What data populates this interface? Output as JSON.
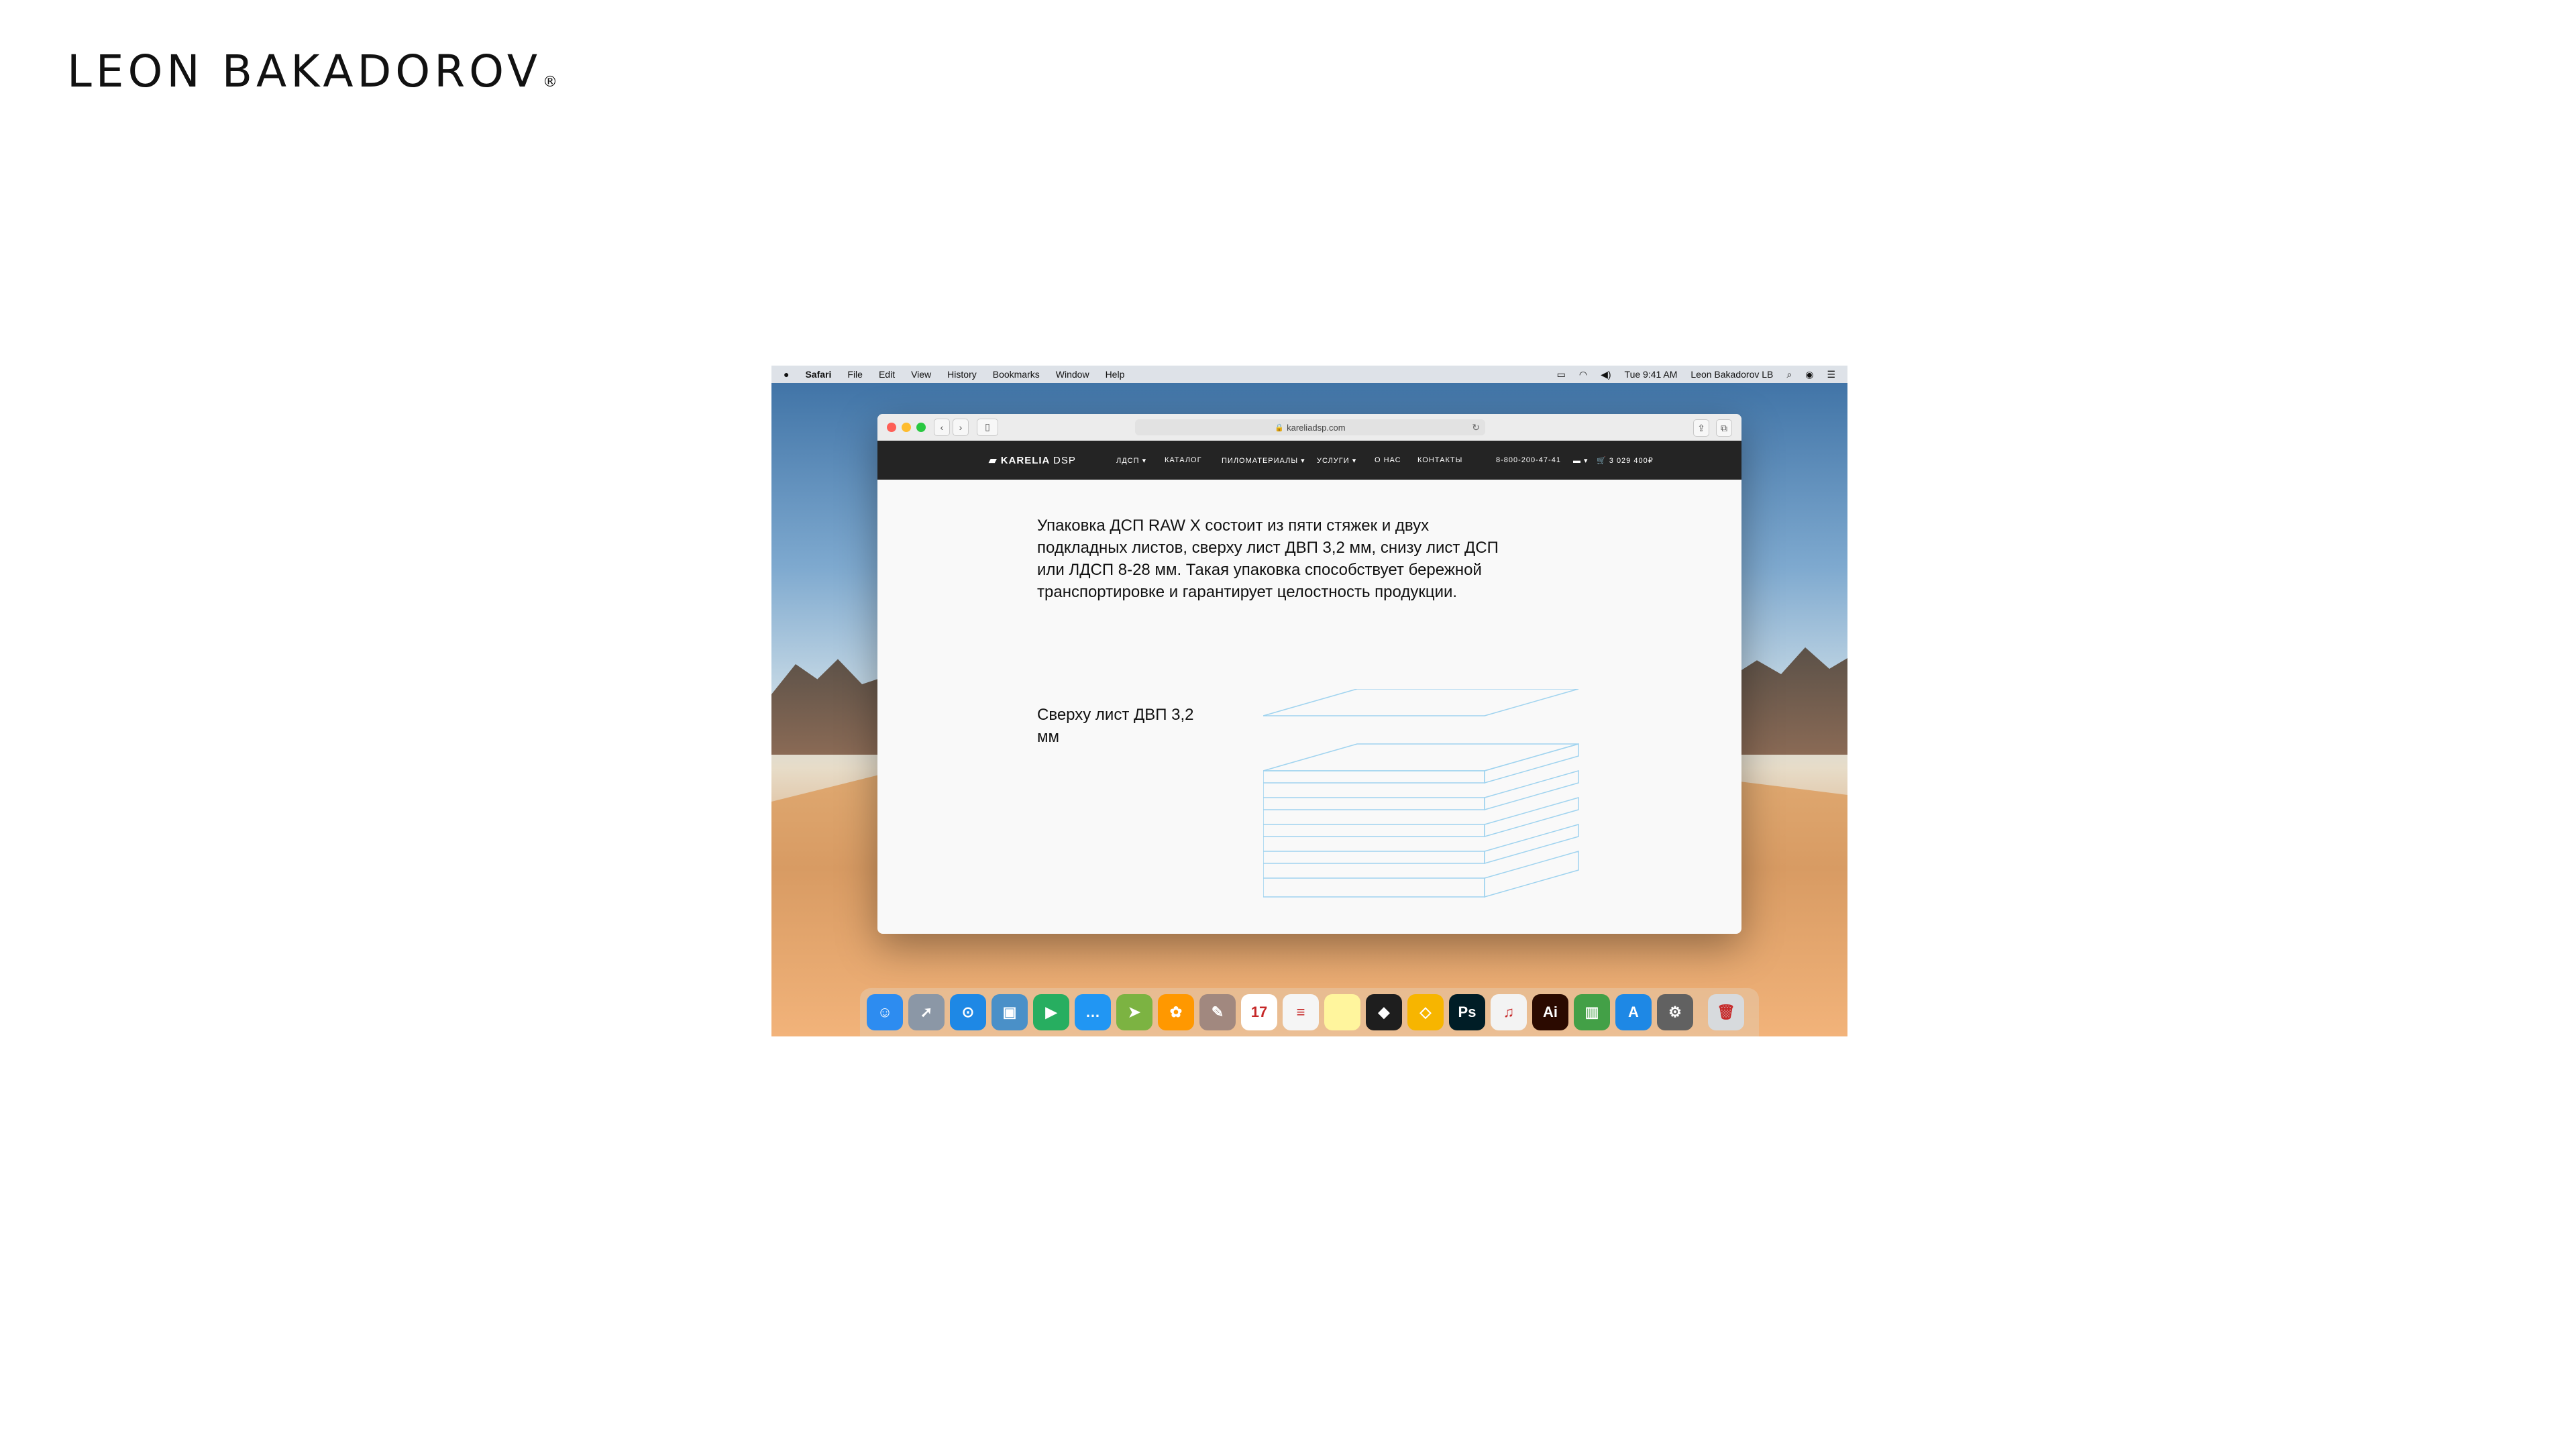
{
  "brand": {
    "name": "LEON BAKADOROV",
    "mark": "®"
  },
  "menubar": {
    "apple_icon": "apple-icon",
    "app": "Safari",
    "menus": [
      "File",
      "Edit",
      "View",
      "History",
      "Bookmarks",
      "Window",
      "Help"
    ],
    "clock": "Tue 9:41 AM",
    "user": "Leon Bakadorov LB"
  },
  "browser": {
    "url": "kareliadsp.com"
  },
  "site": {
    "logo_main": "KARELIA",
    "logo_sub": "DSP",
    "nav": [
      "ЛДСП",
      "КАТАЛОГ",
      "ПИЛОМАТЕРИАЛЫ",
      "УСЛУГИ",
      "О НАС",
      "КОНТАКТЫ"
    ],
    "phone": "8-800-200-47-41",
    "cart": "3 029 400₽",
    "intro": "Упаковка ДСП RAW X состоит из пяти стяжек и двух подкладных листов, сверху лист ДВП 3,2 мм, снизу лист ДСП или ЛДСП 8-28 мм. Такая упаковка способствует бережной транспортировке и гарантирует целостность продукции.",
    "caption": "Сверху лист ДВП 3,2 мм"
  },
  "dock": {
    "apps": [
      {
        "name": "Finder",
        "color": "#2d8cf0",
        "glyph": "☺"
      },
      {
        "name": "Launchpad",
        "color": "#8b97a6",
        "glyph": "➚"
      },
      {
        "name": "Safari",
        "color": "#1e88e5",
        "glyph": "⊙"
      },
      {
        "name": "Preview",
        "color": "#4a90c8",
        "glyph": "▣"
      },
      {
        "name": "FaceTime",
        "color": "#27ae60",
        "glyph": "▶"
      },
      {
        "name": "Messages",
        "color": "#2196f3",
        "glyph": "…"
      },
      {
        "name": "Maps",
        "color": "#7cb342",
        "glyph": "➤"
      },
      {
        "name": "Photos",
        "color": "#ff9800",
        "glyph": "✿"
      },
      {
        "name": "Notes",
        "color": "#a1887f",
        "glyph": "✎"
      },
      {
        "name": "Calendar",
        "color": "#ffffff",
        "glyph": "17"
      },
      {
        "name": "Reminders",
        "color": "#f5f5f5",
        "glyph": "≡"
      },
      {
        "name": "Stickies",
        "color": "#fff59d",
        "glyph": ""
      },
      {
        "name": "Figma",
        "color": "#1e1e1e",
        "glyph": "◆"
      },
      {
        "name": "Sketch",
        "color": "#f7b500",
        "glyph": "◇"
      },
      {
        "name": "Photoshop",
        "color": "#001d26",
        "glyph": "Ps"
      },
      {
        "name": "iTunes",
        "color": "#f3f3f3",
        "glyph": "♫"
      },
      {
        "name": "Illustrator",
        "color": "#2b0a00",
        "glyph": "Ai"
      },
      {
        "name": "Numbers",
        "color": "#43a047",
        "glyph": "▥"
      },
      {
        "name": "App Store",
        "color": "#1e88e5",
        "glyph": "A"
      },
      {
        "name": "System Preferences",
        "color": "#616161",
        "glyph": "⚙"
      },
      {
        "name": "Trash",
        "color": "#d7dadd",
        "glyph": "🗑"
      }
    ]
  }
}
